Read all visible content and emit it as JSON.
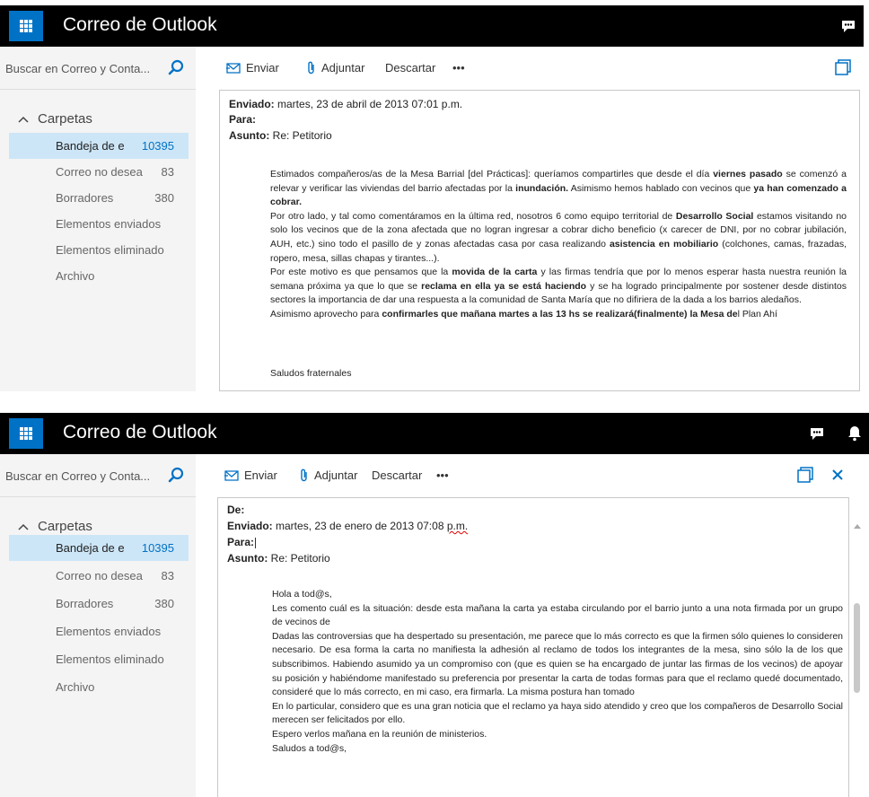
{
  "app": {
    "title": "Correo de Outlook"
  },
  "search": {
    "placeholder": "Buscar en Correo y Conta..."
  },
  "commands": {
    "send": "Enviar",
    "attach": "Adjuntar",
    "discard": "Descartar",
    "more": "•••"
  },
  "sidebar": {
    "header": "Carpetas",
    "folders": [
      {
        "label": "Bandeja de e",
        "count": "10395"
      },
      {
        "label": "Correo no desea",
        "count": "83"
      },
      {
        "label": "Borradores",
        "count": "380"
      },
      {
        "label": "Elementos enviados",
        "count": ""
      },
      {
        "label": "Elementos eliminado",
        "count": ""
      },
      {
        "label": "Archivo",
        "count": ""
      }
    ]
  },
  "email1": {
    "sent_label": "Enviado:",
    "sent_value": "martes, 23 de abril de 2013 07:01 p.m.",
    "to_label": "Para:",
    "subject_label": "Asunto:",
    "subject_value": "Re: Petitorio",
    "p1a": "Estimados compañeros/as de la Mesa Barrial [del Prácticas]: queríamos compartirles que desde el día ",
    "p1b": "viernes pasado",
    "p1c": " se comenzó a relevar y verificar las viviendas del barrio afectadas por la ",
    "p1d": "inundación.",
    "p1e": " Asimismo hemos hablado con vecinos que ",
    "p1f": "ya han comenzado a cobrar.",
    "p2a": "Por otro lado, y tal como comentáramos en la última red, nosotros 6 como equipo territorial de ",
    "p2b": "Desarrollo Social",
    "p2c": " estamos visitando no solo los vecinos que de la zona afectada que no logran ingresar a cobrar dicho beneficio (x carecer de DNI, por no cobrar jubilación, AUH, etc.) sino todo el pasillo de y zonas afectadas casa por casa realizando ",
    "p2d": "asistencia en mobiliario",
    "p2e": " (colchones, camas, frazadas, ropero, mesa, sillas chapas y tirantes...).",
    "p3a": "Por este motivo es que pensamos que la ",
    "p3b": "movida de la carta",
    "p3c": " y las firmas tendría que por lo menos esperar hasta nuestra reunión la semana próxima ya que lo que se ",
    "p3d": "reclama en ella ya se está haciendo",
    "p3e": " y se ha logrado principalmente por sostener desde distintos sectores la importancia de dar una respuesta a la comunidad de Santa María que no difiriera de la dada a los barrios aledaños.",
    "p4a": "Asimismo aprovecho para ",
    "p4b": "confirmarles que mañana martes a las 13 hs se realizará(finalmente) la Mesa de",
    "p4c": "l Plan Ahí",
    "closing": "Saludos fraternales"
  },
  "email2": {
    "from_label": "De:",
    "sent_label": "Enviado:",
    "sent_value_a": "martes, 23 de enero de 2013 07:08 ",
    "sent_value_b": "p.m.",
    "to_label": "Para:",
    "subject_label": "Asunto:",
    "subject_value": "Re: Petitorio",
    "greeting": "Hola a tod@s,",
    "p1": "Les comento cuál es la situación: desde esta mañana la carta ya estaba circulando por el barrio junto a una nota firmada por un grupo de vecinos de",
    "p2": "Dadas las controversias que ha despertado su presentación, me parece que lo más correcto es que la firmen sólo quienes lo consideren necesario. De esa forma la carta no manifiesta la adhesión al reclamo de todos los integrantes de la mesa, sino sólo la de los que subscribimos. Habiendo asumido ya un compromiso con (que es quien se ha encargado de juntar las firmas de los vecinos) de apoyar su posición y habiéndome manifestado su preferencia por presentar la carta de todas formas para que el reclamo quedé documentado, consideré que lo más correcto, en mi caso, era firmarla. La misma postura han tomado",
    "p3": "En lo particular, considero que es una gran noticia que el reclamo ya haya sido atendido y creo que los compañeros de Desarrollo Social merecen ser felicitados por ello.",
    "p4": "Espero verlos mañana en la reunión de ministerios.",
    "closing": "Saludos a tod@s,"
  },
  "colors": {
    "topbar": "#000000",
    "accent": "#0072c6",
    "selected": "#cde6f7",
    "sidebar": "#f4f4f4"
  },
  "icons": [
    "app-launcher-icon",
    "chat-icon",
    "bell-icon",
    "search-icon",
    "send-icon",
    "paperclip-icon",
    "popout-icon",
    "close-icon",
    "chevron-up-icon"
  ]
}
